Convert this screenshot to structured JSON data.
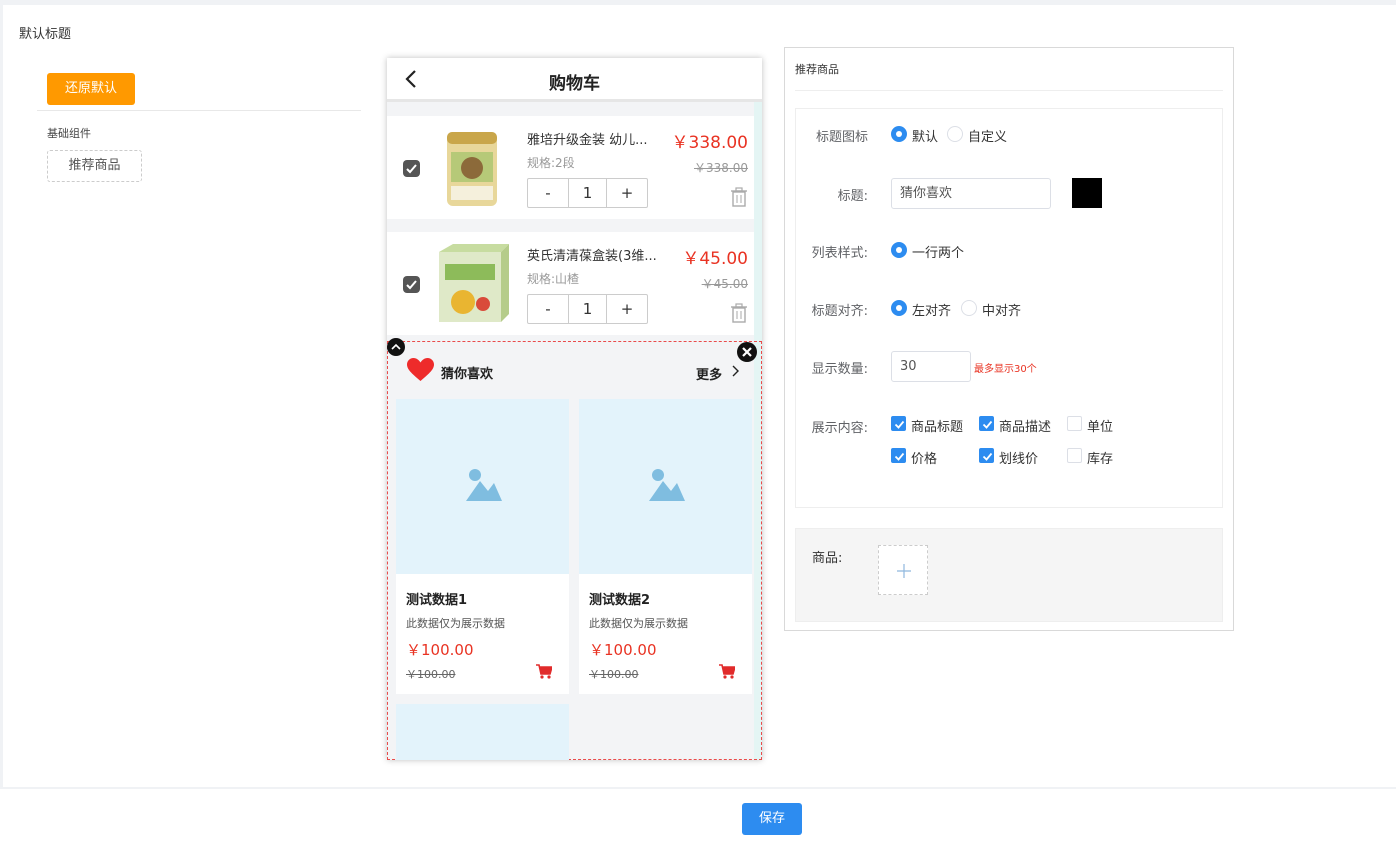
{
  "page": {
    "title": "默认标题"
  },
  "left": {
    "restore_label": "还原默认",
    "basic_section_label": "基础组件",
    "component_chip": "推荐商品"
  },
  "phone": {
    "title": "购物车",
    "cart_items": [
      {
        "name": "雅培升级金装 幼儿...",
        "spec": "规格:2段",
        "qty": "1",
        "price": "￥338.00",
        "old_price": "￥338.00",
        "checked": true
      },
      {
        "name": "英氏清清葆盒装(3维...",
        "spec": "规格:山楂",
        "qty": "1",
        "price": "￥45.00",
        "old_price": "￥45.00",
        "checked": true
      }
    ],
    "stepper": {
      "minus": "-",
      "plus": "+"
    },
    "recommend": {
      "title": "猜你喜欢",
      "more": "更多",
      "cards": [
        {
          "title": "测试数据1",
          "desc": "此数据仅为展示数据",
          "price": "￥100.00",
          "old_price": "￥100.00"
        },
        {
          "title": "测试数据2",
          "desc": "此数据仅为展示数据",
          "price": "￥100.00",
          "old_price": "￥100.00"
        }
      ]
    }
  },
  "panel": {
    "title": "推荐商品",
    "title_icon": {
      "label": "标题图标",
      "options": [
        "默认",
        "自定义"
      ],
      "selected": "默认"
    },
    "title_field": {
      "label": "标题:",
      "value": "猜你喜欢",
      "color": "#000000"
    },
    "list_style": {
      "label": "列表样式:",
      "options": [
        "一行两个"
      ],
      "selected": "一行两个"
    },
    "title_align": {
      "label": "标题对齐:",
      "options": [
        "左对齐",
        "中对齐"
      ],
      "selected": "左对齐"
    },
    "count": {
      "label": "显示数量:",
      "value": "30",
      "hint": "最多显示30个"
    },
    "content": {
      "label": "展示内容:",
      "options": [
        {
          "label": "商品标题",
          "checked": true
        },
        {
          "label": "商品描述",
          "checked": true
        },
        {
          "label": "单位",
          "checked": false
        },
        {
          "label": "价格",
          "checked": true
        },
        {
          "label": "划线价",
          "checked": true
        },
        {
          "label": "库存",
          "checked": false
        }
      ]
    },
    "goods": {
      "label": "商品:"
    }
  },
  "footer": {
    "save_label": "保存"
  },
  "colors": {
    "accent": "#2d8cf0",
    "restore": "#ff9900",
    "price": "#e93323"
  }
}
